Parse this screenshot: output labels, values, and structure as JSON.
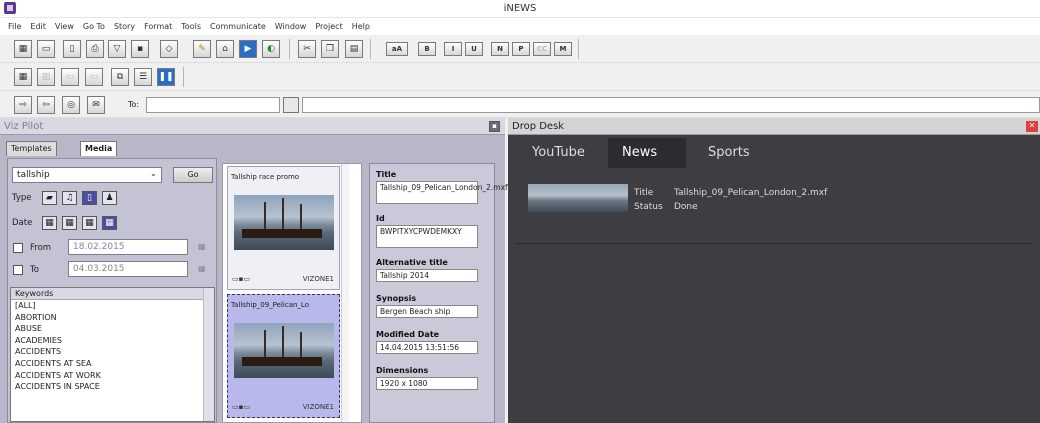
{
  "app": {
    "title": "iNEWS"
  },
  "menu": [
    "File",
    "Edit",
    "View",
    "Go To",
    "Story",
    "Format",
    "Tools",
    "Communicate",
    "Window",
    "Project",
    "Help"
  ],
  "toolbar": {
    "row1_icons": [
      "layout-icon",
      "window-icon",
      "document-icon",
      "print-icon",
      "filter-icon",
      "save-icon",
      "erase-icon",
      "pencil-icon",
      "lock-icon",
      "film-icon",
      "globe-icon"
    ],
    "row1_edit_icons": [
      "cut-icon",
      "copy-icon",
      "paste-icon"
    ],
    "format_buttons": [
      "aA",
      "B",
      "I",
      "U",
      "N",
      "P",
      "CC",
      "M"
    ],
    "row2_icons": [
      "grid-icon",
      "panel-icon",
      "panel2-icon",
      "panel3-icon",
      "split-icon",
      "columns-icon",
      "pause-icon"
    ],
    "row3_icons": [
      "send-icon",
      "reply-icon",
      "attach-icon",
      "mail-icon"
    ],
    "to_label": "To:"
  },
  "viz_pilot": {
    "title": "Viz Pilot",
    "tabs": [
      "Templates",
      "Media"
    ],
    "search_value": "tallship",
    "go_label": "Go",
    "type_label": "Type",
    "date_label": "Date",
    "from_label": "From",
    "from_value": "18.02.2015",
    "to_label": "To",
    "to_value": "04.03.2015",
    "keywords_header": "Keywords",
    "keywords": [
      "[ALL]",
      "ABORTION",
      "ABUSE",
      "ACADEMIES",
      "ACCIDENTS",
      "ACCIDENTS AT SEA",
      "ACCIDENTS AT WORK",
      "ACCIDENTS IN SPACE"
    ],
    "media": [
      {
        "title": "Tallship race promo",
        "zone": "VIZONE1"
      },
      {
        "title": "Tallship_09_Pelican_Lo",
        "zone": "VIZONE1"
      }
    ],
    "metadata": [
      {
        "label": "Title",
        "value": "Tallship_09_Pelican_London_2.mxf"
      },
      {
        "label": "Id",
        "value": "BWPITXYCPWDEMKXY"
      },
      {
        "label": "Alternative title",
        "value": "Tallship 2014"
      },
      {
        "label": "Synopsis",
        "value": "Bergen Beach ship"
      },
      {
        "label": "Modified Date",
        "value": "14.04.2015 13:51:56"
      },
      {
        "label": "Dimensions",
        "value": "1920 x 1080"
      }
    ]
  },
  "drop_desk": {
    "title": "Drop Desk",
    "tabs": [
      "YouTube",
      "News",
      "Sports"
    ],
    "active_tab": "News",
    "item": {
      "title_label": "Title",
      "title_value": "Tallship_09_Pelican_London_2.mxf",
      "status_label": "Status",
      "status_value": "Done"
    }
  }
}
